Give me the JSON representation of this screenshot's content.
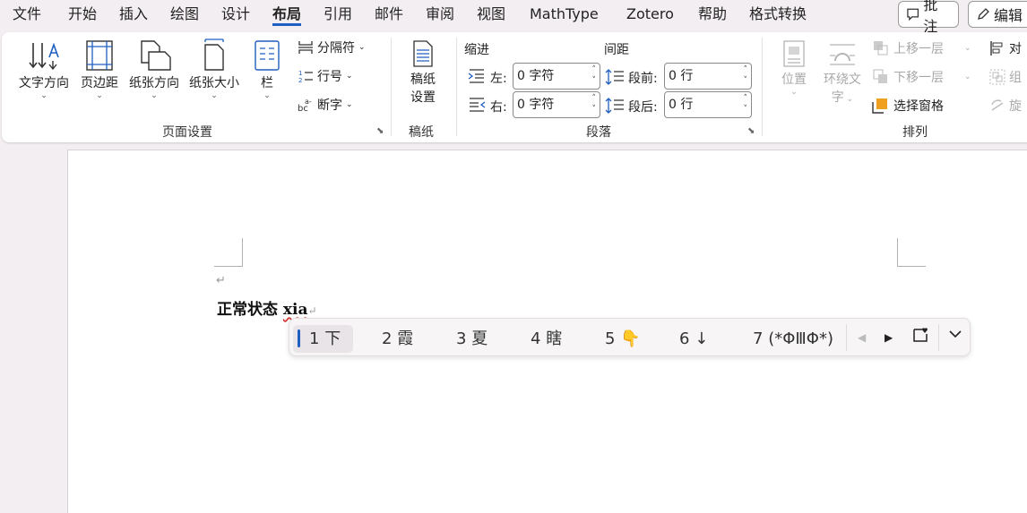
{
  "menu": {
    "tabs": [
      "文件",
      "开始",
      "插入",
      "绘图",
      "设计",
      "布局",
      "引用",
      "邮件",
      "审阅",
      "视图",
      "MathType",
      "Zotero",
      "帮助",
      "格式转换"
    ],
    "active": "布局",
    "comment_btn": "批注",
    "edit_btn": "编辑"
  },
  "ribbon": {
    "page_setup": {
      "text_direction": "文字方向",
      "margins": "页边距",
      "orientation": "纸张方向",
      "size": "纸张大小",
      "columns": "栏",
      "breaks": "分隔符",
      "line_numbers": "行号",
      "hyphenation": "断字",
      "group_label": "页面设置"
    },
    "manuscript": {
      "button_line1": "稿纸",
      "button_line2": "设置",
      "group_label": "稿纸"
    },
    "paragraph": {
      "indent_label": "缩进",
      "spacing_label": "间距",
      "left_label": "左:",
      "left_value": "0 字符",
      "right_label": "右:",
      "right_value": "0 字符",
      "before_label": "段前:",
      "before_value": "0 行",
      "after_label": "段后:",
      "after_value": "0 行",
      "group_label": "段落"
    },
    "arrange": {
      "position": "位置",
      "wrap_line1": "环绕文",
      "wrap_line2": "字",
      "bring_forward": "上移一层",
      "send_backward": "下移一层",
      "selection_pane": "选择窗格",
      "align": "对",
      "group": "组",
      "rotate": "旋",
      "group_label": "排列"
    }
  },
  "document": {
    "text": "正常状态 ",
    "pinyin": "xia"
  },
  "ime": {
    "candidates": [
      {
        "num": "1",
        "text": "下"
      },
      {
        "num": "2",
        "text": "霞"
      },
      {
        "num": "3",
        "text": "夏"
      },
      {
        "num": "4",
        "text": "瞎"
      },
      {
        "num": "5",
        "text": "👇"
      },
      {
        "num": "6",
        "text": "↓"
      },
      {
        "num": "7",
        "text": "(*ΦⅢΦ*)"
      }
    ],
    "selected_index": 0
  },
  "colors": {
    "accent": "#1f5fbf",
    "ribbon_bg": "#ffffff",
    "app_bg": "#f3eef1",
    "spellcheck": "#d0342c"
  }
}
